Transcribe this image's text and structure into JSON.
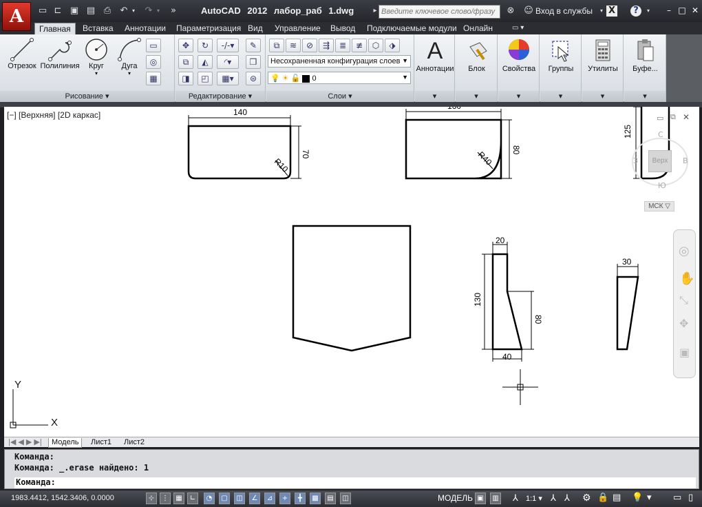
{
  "app": {
    "logo": "A",
    "title": "AutoCAD 2012",
    "filename": "лабор_раб 1.dwg",
    "search_placeholder": "Введите ключевое слово/фразу",
    "signin": "Вход в службы"
  },
  "tabs": [
    "Главная",
    "Вставка",
    "Аннотации",
    "Параметризация",
    "Вид",
    "Управление",
    "Вывод",
    "Подключаемые модули",
    "Онлайн"
  ],
  "ribbon": {
    "draw": {
      "title": "Рисование ▾",
      "line": "Отрезок",
      "polyline": "Полилиния",
      "circle": "Круг",
      "arc": "Дуга"
    },
    "modify": {
      "title": "Редактирование ▾"
    },
    "layers": {
      "title": "Слои ▾",
      "config": "Несохраненная конфигурация слоев",
      "current": "0"
    },
    "annotation": "Аннотации",
    "block": "Блок",
    "properties": "Свойства",
    "groups": "Группы",
    "utilities": "Утилиты",
    "clipboard": "Буфе..."
  },
  "viewport": {
    "label": "[−] [Верхняя] [2D каркас]",
    "viewcube": "Верх",
    "wcs": "МСК",
    "dims": {
      "d140": "140",
      "d70": "70",
      "r10": "R10",
      "d160": "160",
      "d80a": "80",
      "r40": "R40",
      "d125": "125",
      "d20": "20",
      "d130": "130",
      "d80b": "80",
      "d40": "40",
      "d30": "30"
    },
    "axis_y": "Y",
    "axis_x": "X"
  },
  "layout_tabs": [
    "Модель",
    "Лист1",
    "Лист2"
  ],
  "command": {
    "line1": "Команда:",
    "line2": "Команда: _.erase найдено: 1",
    "prompt": "Команда:"
  },
  "status": {
    "coords": "1983.4412, 1542.3406, 0.0000",
    "model": "МОДЕЛЬ",
    "scale": "1:1"
  }
}
